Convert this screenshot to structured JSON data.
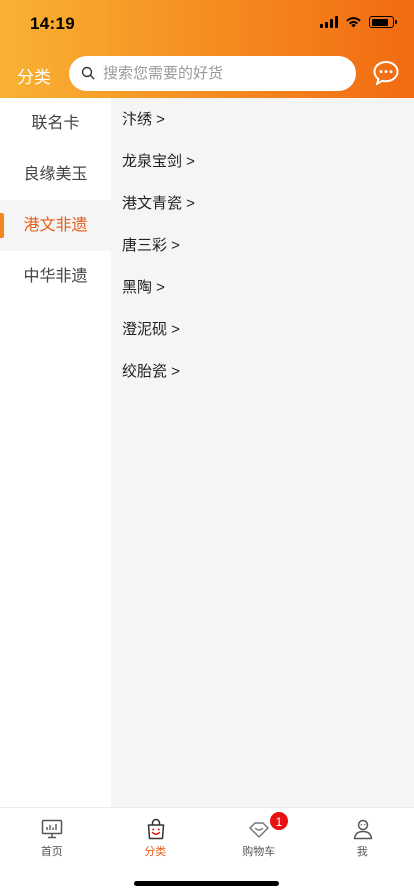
{
  "status_bar": {
    "time": "14:19"
  },
  "header": {
    "title": "分类",
    "search": {
      "placeholder": "搜索您需要的好货"
    },
    "message_icon": "chat-bubble-icon"
  },
  "sidebar": {
    "items": [
      {
        "label": "联名卡",
        "active": false
      },
      {
        "label": "良缘美玉",
        "active": false
      },
      {
        "label": "港文非遗",
        "active": true
      },
      {
        "label": "中华非遗",
        "active": false
      }
    ]
  },
  "content": {
    "categories": [
      {
        "label": "汴绣 >"
      },
      {
        "label": "龙泉宝剑 >"
      },
      {
        "label": "港文青瓷 >"
      },
      {
        "label": "唐三彩 >"
      },
      {
        "label": "黑陶 >"
      },
      {
        "label": "澄泥砚 >"
      },
      {
        "label": "绞胎瓷 >"
      }
    ]
  },
  "tabbar": {
    "tabs": [
      {
        "label": "首页",
        "icon": "monitor-icon",
        "active": false
      },
      {
        "label": "分类",
        "icon": "shopping-bag-icon",
        "active": true
      },
      {
        "label": "购物车",
        "icon": "cart-icon",
        "active": false,
        "badge": "1"
      },
      {
        "label": "我",
        "icon": "user-icon",
        "active": false
      }
    ]
  },
  "colors": {
    "header_gradient_start": "#f9b233",
    "header_gradient_end": "#f26a12",
    "accent": "#e85d18",
    "badge": "#e8110f",
    "content_bg": "#f5f5f5"
  }
}
